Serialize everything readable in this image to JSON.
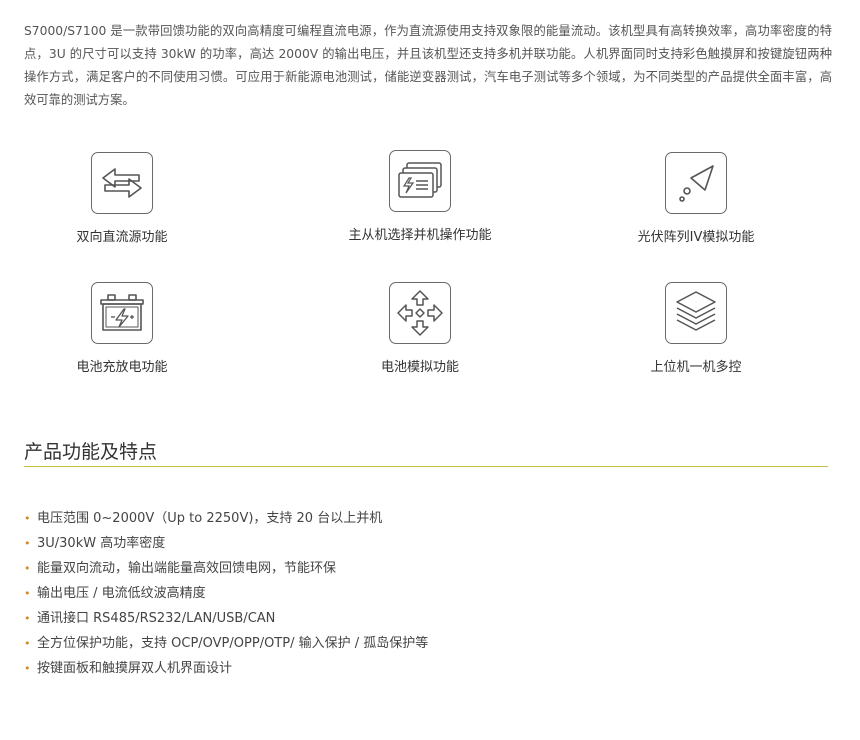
{
  "intro": {
    "text": "S7000/S7100 是一款带回馈功能的双向高精度可编程直流电源，作为直流源使用支持双象限的能量流动。该机型具有高转换效率，高功率密度的特点，3U 的尺寸可以支持 30kW 的功率，高达 2000V 的输出电压，并且该机型还支持多机并联功能。人机界面同时支持彩色触摸屏和按键旋钮两种操作方式，满足客户的不同使用习惯。可应用于新能源电池测试，储能逆变器测试，汽车电子测试等多个领域，为不同类型的产品提供全面丰富，高效可靠的测试方案。"
  },
  "features": [
    {
      "label": "双向直流源功能",
      "icon": "bidirectional-arrows-icon"
    },
    {
      "label": "主从机选择并机操作功能",
      "icon": "stacked-modules-icon"
    },
    {
      "label": "光伏阵列IV模拟功能",
      "icon": "solar-iv-icon"
    },
    {
      "label": "电池充放电功能",
      "icon": "battery-icon"
    },
    {
      "label": "电池模拟功能",
      "icon": "four-way-arrows-icon"
    },
    {
      "label": "上位机一机多控",
      "icon": "layers-icon"
    }
  ],
  "section": {
    "title": "产品功能及特点"
  },
  "specs": [
    "电压范围 0~2000V（Up to 2250V)，支持 20 台以上并机",
    "3U/30kW 高功率密度",
    "能量双向流动，输出端能量高效回馈电网，节能环保",
    "输出电压 / 电流低纹波高精度",
    "通讯接口 RS485/RS232/LAN/USB/CAN",
    "全方位保护功能，支持 OCP/OVP/OPP/OTP/ 输入保护 / 孤岛保护等",
    "按键面板和触摸屏双人机界面设计"
  ],
  "colors": {
    "accent_rule": "#c8bf3a",
    "bullet": "#d4892a",
    "icon_stroke": "#6a6a6a"
  }
}
